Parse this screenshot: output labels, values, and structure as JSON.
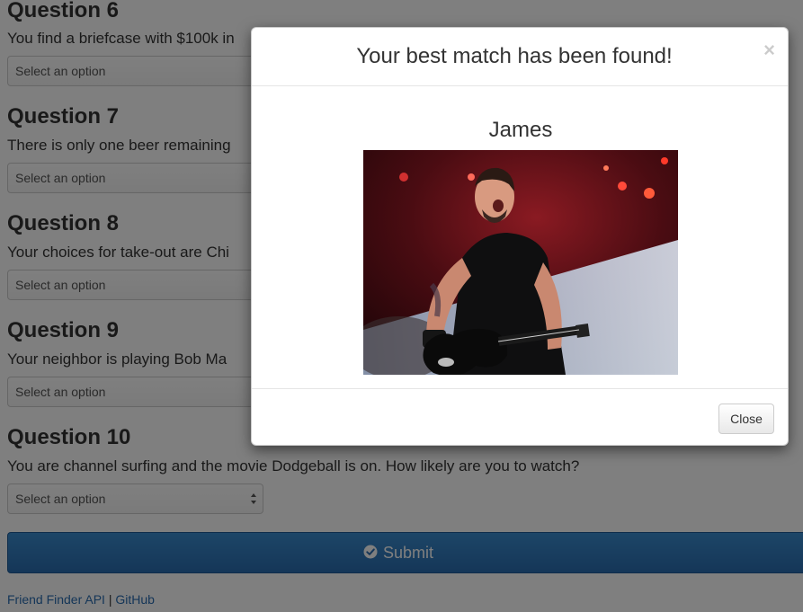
{
  "questions": [
    {
      "title": "Question 6",
      "text": "You find a briefcase with $100k in",
      "select": "Select an option"
    },
    {
      "title": "Question 7",
      "text": "There is only one beer remaining",
      "select": "Select an option"
    },
    {
      "title": "Question 8",
      "text": "Your choices for take-out are Chi",
      "select": "Select an option"
    },
    {
      "title": "Question 9",
      "text": "Your neighbor is playing Bob Ma",
      "select": "Select an option"
    },
    {
      "title": "Question 10",
      "text": "You are channel surfing and the movie Dodgeball is on. How likely are you to watch?",
      "select": "Select an option"
    }
  ],
  "submit": {
    "label": "Submit",
    "icon": "check-circle-icon",
    "color": "#2a6db0"
  },
  "footer": {
    "api_link": "Friend Finder API",
    "separator": "|",
    "github_link": "GitHub"
  },
  "modal": {
    "title": "Your best match has been found!",
    "close_x": "×",
    "match_name": "James",
    "photo_icon": "match-photo",
    "close_button": "Close"
  }
}
